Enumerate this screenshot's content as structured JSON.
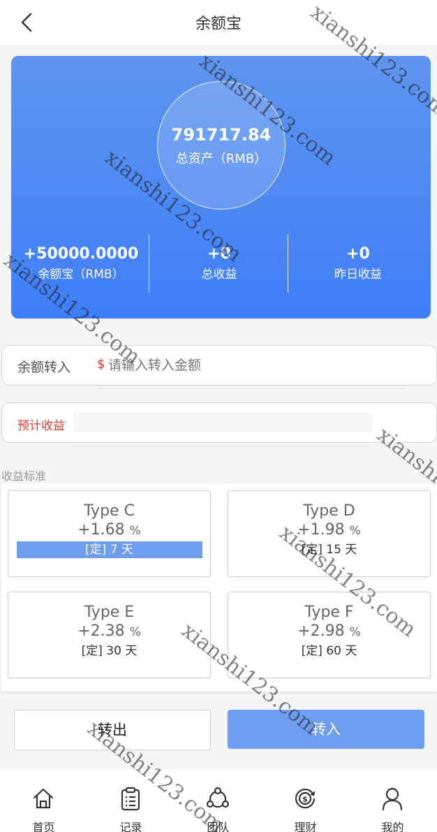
{
  "header": {
    "title": "余额宝"
  },
  "hero": {
    "total_amount": "791717.84",
    "total_label": "总资产（RMB）",
    "stats": [
      {
        "value": "+50000.0000",
        "label": "余额宝（RMB）"
      },
      {
        "value": "+0",
        "label": "总收益"
      },
      {
        "value": "+0",
        "label": "昨日收益"
      }
    ]
  },
  "transfer": {
    "label": "余额转入",
    "currency_symbol": "$",
    "placeholder": "请输入转入金额"
  },
  "estimate": {
    "label": "预计收益"
  },
  "standards": {
    "title": "收益标准",
    "pct_symbol": "%",
    "plans": [
      {
        "name": "Type C",
        "rate": "+1.68",
        "term": "[定] 7 天",
        "selected": true
      },
      {
        "name": "Type D",
        "rate": "+1.98",
        "term": "[定] 15 天",
        "selected": false
      },
      {
        "name": "Type E",
        "rate": "+2.38",
        "term": "[定] 30 天",
        "selected": false
      },
      {
        "name": "Type F",
        "rate": "+2.98",
        "term": "[定] 60 天",
        "selected": false
      }
    ]
  },
  "actions": {
    "out_label": "转出",
    "in_label": "转入"
  },
  "nav": {
    "items": [
      {
        "label": "首页",
        "icon": "home-icon"
      },
      {
        "label": "记录",
        "icon": "clipboard-icon"
      },
      {
        "label": "团队",
        "icon": "team-icon"
      },
      {
        "label": "理财",
        "icon": "money-icon"
      },
      {
        "label": "我的",
        "icon": "user-icon"
      }
    ]
  },
  "watermark": {
    "text": "xianshi123.com"
  },
  "colors": {
    "accent": "#6d9ef0",
    "hero_top": "#5e95ee",
    "hero_bottom": "#3f7ef9",
    "alert_red": "#e03b2a"
  }
}
